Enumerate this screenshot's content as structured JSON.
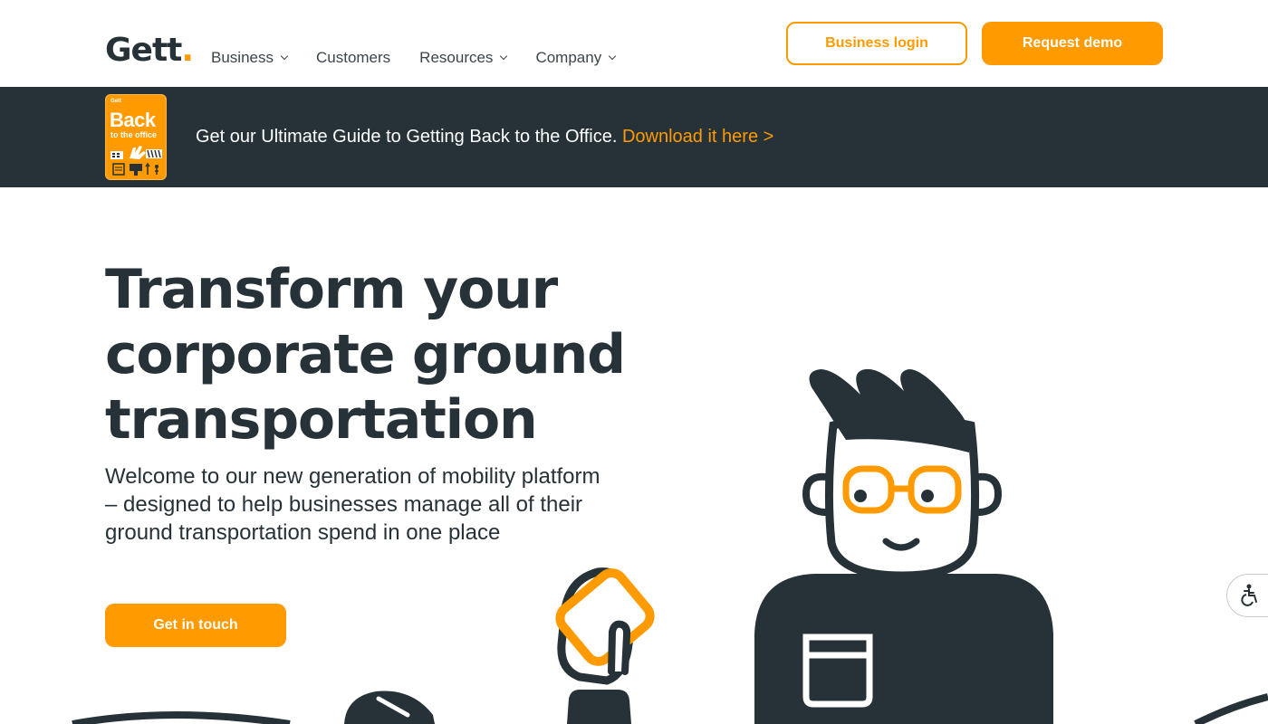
{
  "header": {
    "logo_text": "Gett",
    "logo_dot": ".",
    "nav": [
      {
        "label": "Business",
        "dropdown": true
      },
      {
        "label": "Customers",
        "dropdown": false
      },
      {
        "label": "Resources",
        "dropdown": true
      },
      {
        "label": "Company",
        "dropdown": true
      }
    ],
    "business_login_label": "Business login",
    "request_demo_label": "Request demo"
  },
  "banner": {
    "book": {
      "brand": "Gett",
      "title": "Back",
      "subtitle": "to the office"
    },
    "text": "Get our Ultimate Guide to Getting Back to the Office.",
    "link_text": "Download it here >"
  },
  "hero": {
    "title_lines": [
      "Transform your",
      "corporate ground",
      "transportation"
    ],
    "subtitle": "Welcome to our new generation of mobility platform – designed to help businesses manage all of their ground transportation spend in one place",
    "cta_label": "Get in touch"
  },
  "icons": {
    "accessibility": "accessibility-icon",
    "chevron": "chevron-down-icon"
  },
  "colors": {
    "brand_orange": "#ff9b00",
    "dark": "#263238",
    "white": "#ffffff"
  }
}
